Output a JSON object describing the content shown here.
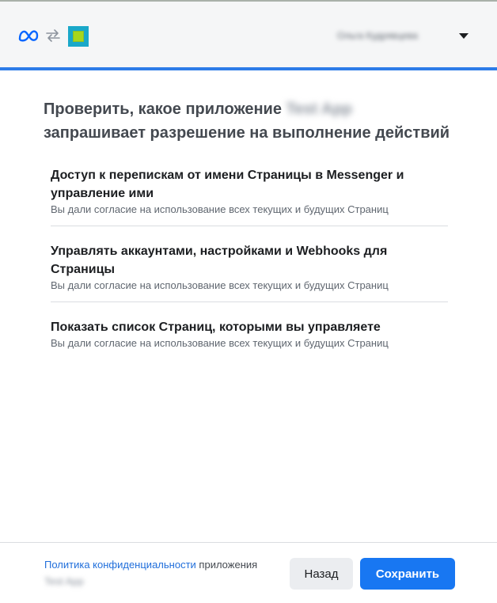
{
  "header": {
    "logo_icon": "meta-logo-icon",
    "swap_icon": "swap-arrows-icon",
    "app_icon": "app-icon",
    "account_name": "Ольга Кудрявцева",
    "caret_icon": "caret-down-icon"
  },
  "title": {
    "text": "Проверить, какое приложение",
    "app_name": "Test App",
    "text_rest": "запрашивает разрешение на выполнение действий"
  },
  "permissions": [
    {
      "title": "Доступ к перепискам от имени Страницы в Messenger и управление ими",
      "description": "Вы дали согласие на использование всех текущих и будущих Страниц"
    },
    {
      "title": "Управлять аккаунтами, настройками и Webhooks для Страницы",
      "description": "Вы дали согласие на использование всех текущих и будущих Страниц"
    },
    {
      "title": "Показать список Страниц, которыми вы управляете",
      "description": "Вы дали согласие на использование всех текущих и будущих Страниц"
    }
  ],
  "footer": {
    "policy_link": "Политика конфиденциальности",
    "policy_suffix": "приложения",
    "policy_app_name": "Test App",
    "back_label": "Назад",
    "save_label": "Сохранить"
  },
  "colors": {
    "accent": "#1877f2",
    "header_stripe": "#2d7ce8",
    "link": "#216fdb"
  }
}
